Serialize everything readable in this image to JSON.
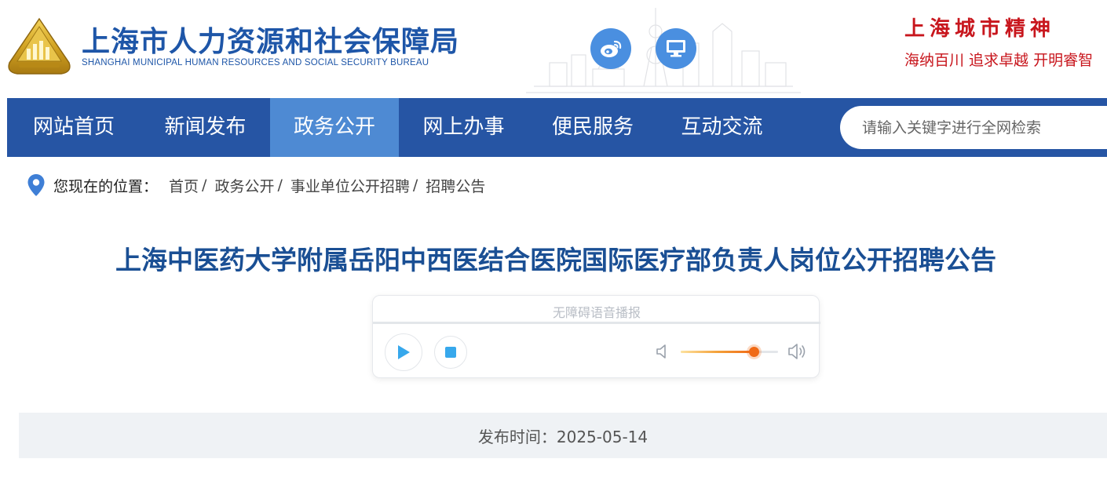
{
  "header": {
    "site_title": "上海市人力资源和社会保障局",
    "site_subtitle": "SHANGHAI MUNICIPAL HUMAN RESOURCES AND SOCIAL SECURITY BUREAU",
    "city_spirit_title": "上海城市精神",
    "city_spirit_slogan": "海纳百川  追求卓越  开明睿智",
    "social_icons": [
      "weibo-icon",
      "computer-icon"
    ],
    "colors": {
      "brand_blue": "#1e56a8",
      "accent_red": "#c8161d",
      "social_blue": "#4a8fe0"
    }
  },
  "nav": {
    "items": [
      {
        "label": "网站首页"
      },
      {
        "label": "新闻发布"
      },
      {
        "label": "政务公开",
        "active": true
      },
      {
        "label": "网上办事"
      },
      {
        "label": "便民服务"
      },
      {
        "label": "互动交流"
      }
    ],
    "search_placeholder": "请输入关键字进行全网检索",
    "colors": {
      "bar": "#2655a4",
      "active": "#4e8ad3"
    }
  },
  "breadcrumb": {
    "prefix": "您现在的位置：",
    "items": [
      "首页",
      "政务公开",
      "事业单位公开招聘",
      "招聘公告"
    ],
    "separator": "/"
  },
  "article": {
    "title": "上海中医药大学附属岳阳中西医结合医院国际医疗部负责人岗位公开招聘公告",
    "publish_time": "发布时间：2025-05-14"
  },
  "audio_player": {
    "label": "无障碍语音播报",
    "progress_fraction": 0.0,
    "volume_fraction": 0.75
  }
}
